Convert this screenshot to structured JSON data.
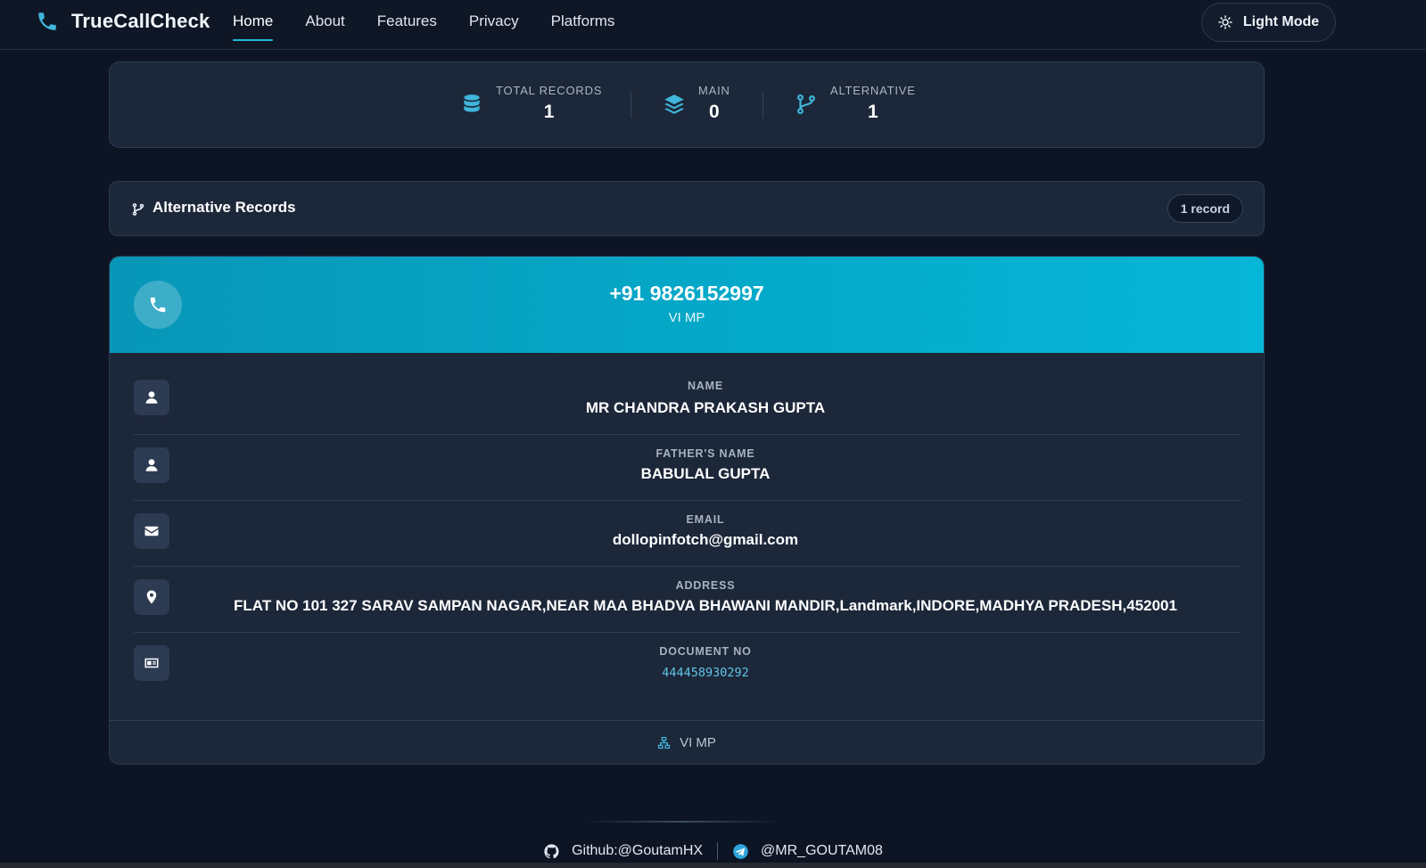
{
  "nav": {
    "brand": "TrueCallCheck",
    "links": [
      {
        "label": "Home",
        "active": true
      },
      {
        "label": "About",
        "active": false
      },
      {
        "label": "Features",
        "active": false
      },
      {
        "label": "Privacy",
        "active": false
      },
      {
        "label": "Platforms",
        "active": false
      }
    ],
    "mode_toggle": "Light Mode"
  },
  "stats": [
    {
      "label": "TOTAL RECORDS",
      "value": "1",
      "icon": "database-icon"
    },
    {
      "label": "MAIN",
      "value": "0",
      "icon": "layers-icon"
    },
    {
      "label": "ALTERNATIVE",
      "value": "1",
      "icon": "branch-icon"
    }
  ],
  "section": {
    "title": "Alternative Records",
    "count": "1 record"
  },
  "record": {
    "number": "+91 9826152997",
    "carrier": "VI MP",
    "fields": [
      {
        "label": "NAME",
        "value": "MR CHANDRA PRAKASH GUPTA",
        "icon": "user-icon"
      },
      {
        "label": "FATHER'S NAME",
        "value": "BABULAL GUPTA",
        "icon": "user-icon"
      },
      {
        "label": "EMAIL",
        "value": "dollopinfotch@gmail.com",
        "icon": "envelope-icon"
      },
      {
        "label": "ADDRESS",
        "value": "FLAT NO 101 327 SARAV SAMPAN NAGAR,NEAR MAA BHADVA BHAWANI MANDIR,Landmark,INDORE,MADHYA PRADESH,452001",
        "icon": "map-pin-icon"
      },
      {
        "label": "DOCUMENT NO",
        "value": "444458930292",
        "icon": "id-card-icon"
      }
    ],
    "footer": "VI MP"
  },
  "footer": {
    "github": "Github:@GoutamHX",
    "telegram": "@MR_GOUTAM08"
  },
  "colors": {
    "accent": "#22b8d6",
    "background": "#0d1524",
    "card": "#1c2739",
    "header_gradient_start": "#0796b8",
    "header_gradient_end": "#06b6d6"
  }
}
